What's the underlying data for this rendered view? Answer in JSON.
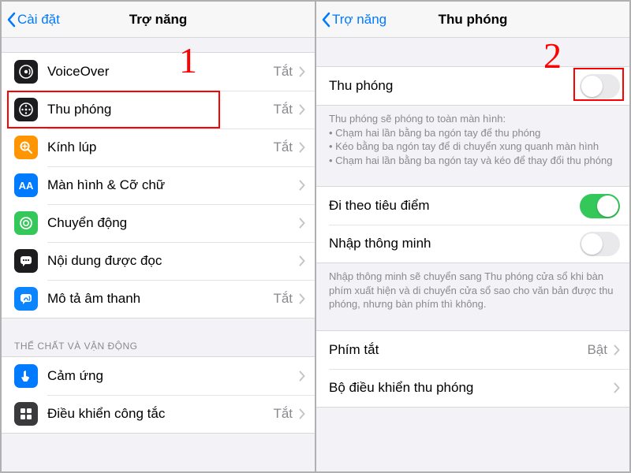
{
  "annotations": {
    "step1": "1",
    "step2": "2"
  },
  "left": {
    "back_label": "Cài đặt",
    "title": "Trợ năng",
    "rows": [
      {
        "label": "VoiceOver",
        "detail": "Tắt"
      },
      {
        "label": "Thu phóng",
        "detail": "Tắt"
      },
      {
        "label": "Kính lúp",
        "detail": "Tắt"
      },
      {
        "label": "Màn hình & Cỡ chữ",
        "detail": ""
      },
      {
        "label": "Chuyển động",
        "detail": ""
      },
      {
        "label": "Nội dung được đọc",
        "detail": ""
      },
      {
        "label": "Mô tả âm thanh",
        "detail": "Tắt"
      }
    ],
    "section2_header": "THỂ CHẤT VÀ VẬN ĐỘNG",
    "section2_rows": [
      {
        "label": "Cảm ứng",
        "detail": ""
      },
      {
        "label": "Điều khiển công tắc",
        "detail": "Tắt"
      }
    ]
  },
  "right": {
    "back_label": "Trợ năng",
    "title": "Thu phóng",
    "zoom_row_label": "Thu phóng",
    "zoom_desc_title": "Thu phóng sẽ phóng to toàn màn hình:",
    "zoom_desc_b1": "Chạm hai lần bằng ba ngón tay để thu phóng",
    "zoom_desc_b2": "Kéo bằng ba ngón tay để di chuyển xung quanh màn hình",
    "zoom_desc_b3": "Chạm hai lần bằng ba ngón tay và kéo để thay đổi thu phóng",
    "follow_focus_label": "Đi theo tiêu điểm",
    "smart_type_label": "Nhập thông minh",
    "smart_type_desc": "Nhập thông minh sẽ chuyển sang Thu phóng cửa sổ khi bàn phím xuất hiện và di chuyển cửa sổ sao cho văn bản được thu phóng, nhưng bàn phím thì không.",
    "shortcut_label": "Phím tắt",
    "shortcut_detail": "Bật",
    "controller_label": "Bộ điều khiển thu phóng"
  }
}
